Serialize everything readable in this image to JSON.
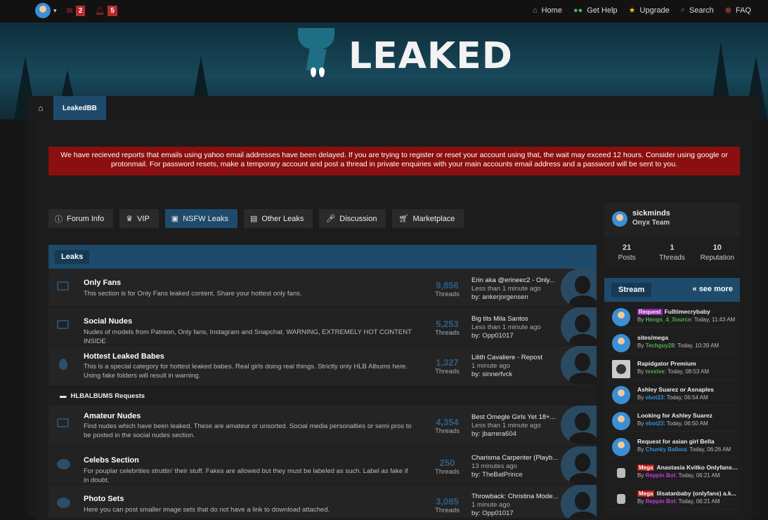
{
  "topbar": {
    "mail_count": "2",
    "alert_count": "5",
    "nav": [
      {
        "label": "Home",
        "icon": "home-icon",
        "color": "#5aa0d6"
      },
      {
        "label": "Get Help",
        "icon": "users-icon",
        "color": "#4caf50"
      },
      {
        "label": "Upgrade",
        "icon": "star-icon",
        "color": "#f1c40f"
      },
      {
        "label": "Search",
        "icon": "search-icon",
        "color": "#b05cd6"
      },
      {
        "label": "FAQ",
        "icon": "close-circle-icon",
        "color": "#d9534f"
      }
    ]
  },
  "logo": {
    "text": "LEAKED"
  },
  "breadcrumb": {
    "active": "LeakedBB"
  },
  "alert": {
    "text": "We have recieved reports that emails using yahoo email addresses have been delayed. If you are trying to register or reset your account using that, the wait may exceed 12 hours. Consider using google or protonmail. For password resets, make a temporary account and post a thread in private enquiries with your main accounts email address and a password will be sent to you."
  },
  "categories": [
    {
      "label": "Forum Info",
      "icon": "info-icon",
      "active": false
    },
    {
      "label": "VIP",
      "icon": "crown-icon",
      "active": false
    },
    {
      "label": "NSFW Leaks",
      "icon": "image-icon",
      "active": true
    },
    {
      "label": "Other Leaks",
      "icon": "book-icon",
      "active": false
    },
    {
      "label": "Discussion",
      "icon": "microphone-icon",
      "active": false
    },
    {
      "label": "Marketplace",
      "icon": "cart-icon",
      "active": false
    }
  ],
  "leaks": {
    "header": "Leaks",
    "threads_label": "Threads",
    "forums": [
      {
        "title": "Only Fans",
        "desc": "This section is for Only Fans leaked content. Share your hottest only fans.",
        "threads": "9,856",
        "last_title": "Erin aka @erineec2 - Only...",
        "last_time": "Less than 1 minute ago",
        "last_by": "by: ankerjorgensen",
        "icon": "image-icon"
      },
      {
        "title": "Social Nudes",
        "desc": "Nudes of models from Patreon, Only fans, Instagram and Snapchat. WARNING, EXTREMELY HOT CONTENT INSIDE",
        "threads": "5,253",
        "last_title": "Big tits Mila Santos",
        "last_time": "Less than 1 minute ago",
        "last_by": "by: Opp01017",
        "icon": "image-icon"
      },
      {
        "title": "Hottest Leaked Babes",
        "desc": "This is a special category for hottest leaked babes. Real girls doing real things. Strictly only HLB Albums here. Using fake folders will result in warning.",
        "threads": "1,327",
        "last_title": "Lilith Cavaliere - Repost",
        "last_time": "1 minute ago",
        "last_by": "by: sinnerfvck",
        "icon": "fire-icon"
      }
    ],
    "subcategory": "HLBALBUMS Requests",
    "forums2": [
      {
        "title": "Amateur Nudes",
        "desc": "Find nudes which have been leaked. These are amateur or unsorted. Social media personalties or semi pros to be posted in the social nudes section.",
        "threads": "4,354",
        "last_title": "Best Omegle Girls Yet 18+...",
        "last_time": "Less than 1 minute ago",
        "last_by": "by: jbarrera604",
        "icon": "image-icon"
      },
      {
        "title": "Celebs Section",
        "desc": "For pouplar celebrities struttin' their stuff. Fakes are allowed but they must be labeled as such. Label as fake if in doubt.",
        "threads": "250",
        "last_title": "Charisma Carpenter (Playb...",
        "last_time": "13 minutes ago",
        "last_by": "by: TheBatPrince",
        "icon": "chat-icon"
      },
      {
        "title": "Photo Sets",
        "desc": "Here you can post smaller image sets that do not have a link to download attached.",
        "threads": "3,085",
        "last_title": "Throwback: Christina Mode...",
        "last_time": "1 minute ago",
        "last_by": "by: Opp01017",
        "icon": "chat-icon"
      }
    ]
  },
  "profile": {
    "name": "sickminds",
    "role": "Onyx Team",
    "stats": [
      {
        "num": "21",
        "label": "Posts"
      },
      {
        "num": "1",
        "label": "Threads"
      },
      {
        "num": "10",
        "label": "Reputation"
      }
    ]
  },
  "stream": {
    "header": "Stream",
    "more": "« see more",
    "items": [
      {
        "prefix": "Request",
        "prefix_color": "#8e24aa",
        "title": "Fulltimecrybaby",
        "by": "By ",
        "author": "Hengs_4_Source",
        "author_color": "#4caf50",
        "time": ": Today, 11:43 AM",
        "avatar": "default"
      },
      {
        "prefix": "",
        "prefix_color": "",
        "title": "sites/mega",
        "by": "By ",
        "author": "Techguy28",
        "author_color": "#4caf50",
        "time": ": Today, 10:39 AM",
        "avatar": "default"
      },
      {
        "prefix": "",
        "prefix_color": "",
        "title": "Rapidgator Premium",
        "by": "By ",
        "author": "texxive",
        "author_color": "#4caf50",
        "time": ": Today, 08:53 AM",
        "avatar": "photo"
      },
      {
        "prefix": "",
        "prefix_color": "",
        "title": "Ashley Suarez or Asnaples",
        "by": "By ",
        "author": "ebot23",
        "author_color": "#2f8fd8",
        "time": ": Today, 06:54 AM",
        "avatar": "default"
      },
      {
        "prefix": "",
        "prefix_color": "",
        "title": "Looking for Ashley Suarez",
        "by": "By ",
        "author": "ebot23",
        "author_color": "#2f8fd8",
        "time": ": Today, 06:50 AM",
        "avatar": "default"
      },
      {
        "prefix": "",
        "prefix_color": "",
        "title": "Request for asian girl Bella",
        "by": "By ",
        "author": "Chunky Balboa",
        "author_color": "#2f8fd8",
        "time": ": Today, 06:26 AM",
        "avatar": "default"
      },
      {
        "prefix": "Mega",
        "prefix_color": "#b71c1c",
        "title": "Anastasia Kvitko Onlyfans -...",
        "by": "By ",
        "author": "Reppin Bot",
        "author_color": "#c13dd6",
        "time": ": Today, 06:21 AM",
        "avatar": "robot"
      },
      {
        "prefix": "Mega",
        "prefix_color": "#b71c1c",
        "title": "lilsatanbaby (onlyfans) a.k...",
        "by": "By ",
        "author": "Reppin Bot",
        "author_color": "#c13dd6",
        "time": ": Today, 06:21 AM",
        "avatar": "robot"
      }
    ]
  }
}
